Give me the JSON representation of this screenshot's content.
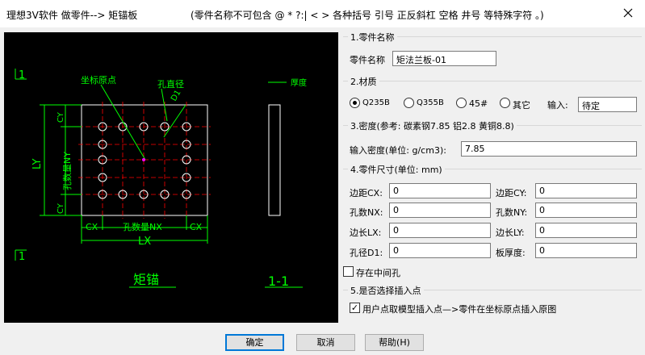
{
  "window": {
    "title": "理想3V软件 做零件--> 矩锚板",
    "hint": "(零件名称不可包含 @ * ?:| < > 各种括号 引号 正反斜杠 空格 井号 等特殊字符 。)"
  },
  "drawing": {
    "label_origin": "坐标原点",
    "label_hole_dia": "孔直径",
    "label_d1": "D1",
    "label_thickness": "厚度",
    "label_1_top": "1",
    "label_1_bottom": "1",
    "label_cy_top": "CY",
    "label_cy_bottom": "CY",
    "label_ny": "孔数量NY",
    "label_ly": "LY",
    "label_cx_left": "CX",
    "label_cx_right": "CX",
    "label_nx": "孔数量NX",
    "label_lx": "LX",
    "label_title": "矩锚",
    "label_section": "1-1"
  },
  "part_name": {
    "group_title": "1.零件名称",
    "label": "零件名称",
    "value": "矩法兰板-01"
  },
  "material": {
    "group_title": "2.材质",
    "options": [
      "Q235B",
      "Q355B",
      "45#",
      "其它"
    ],
    "selected_index": 0,
    "input_label": "输入:",
    "input_value": "待定"
  },
  "density": {
    "group_title": "3.密度(参考: 碳素钢7.85  铝2.8  黄铜8.8)",
    "label": "输入密度(单位: g/cm3):",
    "value": "7.85"
  },
  "dimensions": {
    "group_title": "4.零件尺寸(单位: mm)",
    "fields": [
      {
        "label": "边距CX:",
        "value": "0"
      },
      {
        "label": "边距CY:",
        "value": "0"
      },
      {
        "label": "孔数NX:",
        "value": "0"
      },
      {
        "label": "孔数NY:",
        "value": "0"
      },
      {
        "label": "边长LX:",
        "value": "0"
      },
      {
        "label": "边长LY:",
        "value": "0"
      },
      {
        "label": "孔径D1:",
        "value": "0"
      },
      {
        "label": "板厚度:",
        "value": "0"
      }
    ]
  },
  "middle_hole": {
    "label": "存在中间孔",
    "checked": false
  },
  "insert_point": {
    "group_title": "5.是否选择插入点",
    "label": "用户点取模型插入点—>零件在坐标原点插入原图",
    "checked": true,
    "check_glyph": "✓"
  },
  "buttons": {
    "ok": "确定",
    "cancel": "取消",
    "help": "帮助(H)"
  },
  "colors": {
    "cad_green": "#00ff00",
    "cad_red": "#ff0000",
    "cad_white": "#ffffff",
    "cad_magenta": "#ff00ff"
  }
}
